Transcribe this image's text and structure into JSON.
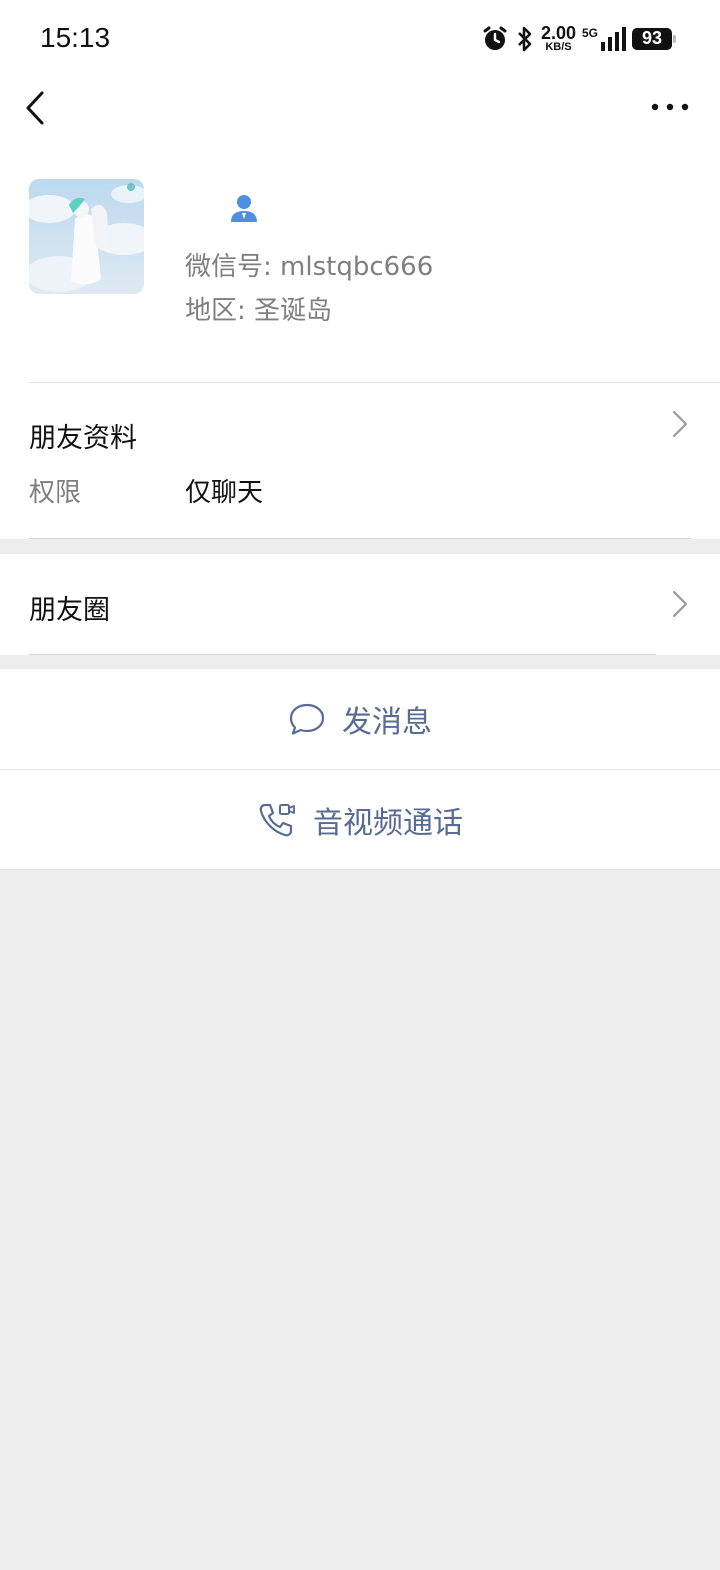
{
  "status_bar": {
    "time": "15:13",
    "speed_value": "2.00",
    "speed_unit": "KB/S",
    "network": "5G",
    "battery": "93"
  },
  "profile": {
    "wechat_id": "微信号: mlstqbc666",
    "region": "地区: 圣诞岛"
  },
  "friend_info": {
    "title": "朋友资料",
    "permission_label": "权限",
    "permission_value": "仅聊天"
  },
  "moments": {
    "title": "朋友圈"
  },
  "actions": {
    "message_label": "发消息",
    "call_label": "音视频通话"
  },
  "colors": {
    "link": "#576b95",
    "page_bg": "#ededed",
    "name_icon": "#4f8fe0"
  }
}
